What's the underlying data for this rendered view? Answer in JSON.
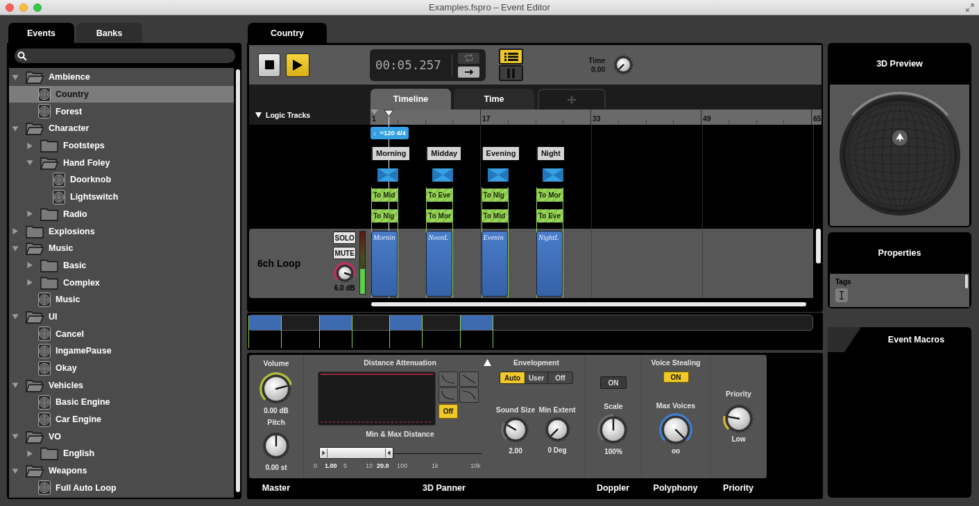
{
  "window": {
    "title": "Examples.fspro – Event Editor"
  },
  "browser": {
    "tabs": [
      {
        "label": "Events",
        "selected": true
      },
      {
        "label": "Banks",
        "selected": false
      }
    ],
    "tree": [
      {
        "kind": "folder",
        "label": "Ambience",
        "expanded": true,
        "selected": false,
        "children": [
          {
            "kind": "event",
            "label": "Country",
            "selected": true
          },
          {
            "kind": "event",
            "label": "Forest",
            "selected": false
          }
        ]
      },
      {
        "kind": "folder",
        "label": "Character",
        "expanded": true,
        "selected": false,
        "children": [
          {
            "kind": "folder",
            "label": "Footsteps",
            "expanded": false,
            "selected": false
          },
          {
            "kind": "folder",
            "label": "Hand Foley",
            "expanded": true,
            "selected": false,
            "children": [
              {
                "kind": "event",
                "label": "Doorknob",
                "selected": false
              },
              {
                "kind": "event",
                "label": "Lightswitch",
                "selected": false
              }
            ]
          },
          {
            "kind": "folder",
            "label": "Radio",
            "expanded": false,
            "selected": false
          }
        ]
      },
      {
        "kind": "folder",
        "label": "Explosions",
        "expanded": false,
        "selected": false
      },
      {
        "kind": "folder",
        "label": "Music",
        "expanded": true,
        "selected": false,
        "children": [
          {
            "kind": "folder",
            "label": "Basic",
            "expanded": false,
            "selected": false
          },
          {
            "kind": "folder",
            "label": "Complex",
            "expanded": false,
            "selected": false
          },
          {
            "kind": "event",
            "label": "Music",
            "selected": false
          }
        ]
      },
      {
        "kind": "folder",
        "label": "UI",
        "expanded": true,
        "selected": false,
        "children": [
          {
            "kind": "event",
            "label": "Cancel",
            "selected": false
          },
          {
            "kind": "event",
            "label": "IngamePause",
            "selected": false
          },
          {
            "kind": "event",
            "label": "Okay",
            "selected": false
          }
        ]
      },
      {
        "kind": "folder",
        "label": "Vehicles",
        "expanded": true,
        "selected": false,
        "children": [
          {
            "kind": "event",
            "label": "Basic Engine",
            "selected": false
          },
          {
            "kind": "event",
            "label": "Car Engine",
            "selected": false
          }
        ]
      },
      {
        "kind": "folder",
        "label": "VO",
        "expanded": true,
        "selected": false,
        "children": [
          {
            "kind": "folder",
            "label": "English",
            "expanded": false,
            "selected": false
          }
        ]
      },
      {
        "kind": "folder",
        "label": "Weapons",
        "expanded": true,
        "selected": false,
        "children": [
          {
            "kind": "event",
            "label": "Full Auto Loop",
            "selected": false
          }
        ]
      }
    ]
  },
  "editor": {
    "tabs": [
      {
        "label": "Country",
        "selected": true
      }
    ],
    "transport": {
      "playing": true,
      "time": "00:05.257",
      "loop": false,
      "toggles": [
        {
          "kind": "list",
          "on": true
        },
        {
          "kind": "pause",
          "on": false
        }
      ],
      "parameter": {
        "label": "Time",
        "value": "0.00"
      }
    },
    "views": [
      {
        "label": "Timeline",
        "selected": true
      },
      {
        "label": "Time",
        "selected": false
      }
    ],
    "logic_tracks": {
      "label": "Logic Tracks",
      "expanded": true
    },
    "ruler": [
      "1",
      "17",
      "33",
      "49",
      "65"
    ],
    "tempo": "♩=120 4/4",
    "markers": [
      {
        "label": "Morning",
        "transitions": [
          "To Mid",
          "To Nig"
        ]
      },
      {
        "label": "Midday",
        "transitions": [
          "To Eve",
          "To Mor"
        ]
      },
      {
        "label": "Evening",
        "transitions": [
          "To Nig",
          "To Mid"
        ]
      },
      {
        "label": "Night",
        "transitions": [
          "To Mor",
          "To Eve"
        ]
      }
    ],
    "track": {
      "name": "6ch Loop",
      "solo": {
        "label": "SOLO",
        "on": false
      },
      "mute": {
        "label": "MUTE",
        "on": false
      },
      "volume": {
        "value": "6.0 dB"
      },
      "meter": {
        "level": 0.4
      },
      "clips": [
        "Mornin",
        "NoonL",
        "Evenin",
        "NightL"
      ]
    }
  },
  "parameters": {
    "master": {
      "label": "Master",
      "volume": {
        "label": "Volume",
        "value": "0.00 dB"
      },
      "pitch": {
        "label": "Pitch",
        "value": "0.00 st"
      }
    },
    "panner": {
      "label": "3D Panner",
      "attenuation": {
        "label": "Distance Attenuation",
        "off": {
          "label": "Off",
          "on": true
        }
      },
      "distance": {
        "label": "Min & Max Distance",
        "min": "1.00",
        "max": "20.0",
        "level": 0.455,
        "scale": [
          "0",
          "5",
          "10",
          "100",
          "1k",
          "10k"
        ]
      },
      "envelopment": {
        "label": "Envelopment",
        "options": [
          {
            "label": "Auto",
            "selected": true
          },
          {
            "label": "User",
            "selected": false
          },
          {
            "label": "Off",
            "selected": false
          }
        ]
      },
      "sound_size": {
        "label": "Sound Size",
        "value": "2.00"
      },
      "min_extent": {
        "label": "Min Extent",
        "value": "0 Deg"
      }
    },
    "doppler": {
      "label": "Doppler",
      "toggle": {
        "label": "ON",
        "on": false
      },
      "scale": {
        "label": "Scale",
        "value": "100%"
      }
    },
    "polyphony": {
      "label": "Polyphony",
      "voice_stealing": {
        "label": "Voice Stealing",
        "toggle": {
          "label": "ON",
          "on": true
        }
      },
      "max_voices": {
        "label": "Max Voices",
        "value": "oo"
      }
    },
    "priority": {
      "label": "Priority",
      "knob": {
        "label": "Priority",
        "value": "Low"
      }
    }
  },
  "side_panels": {
    "preview": {
      "title": "3D Preview"
    },
    "properties": {
      "title": "Properties",
      "tags": {
        "label": "Tags"
      }
    },
    "macros": {
      "title": "Event Macros"
    }
  }
}
